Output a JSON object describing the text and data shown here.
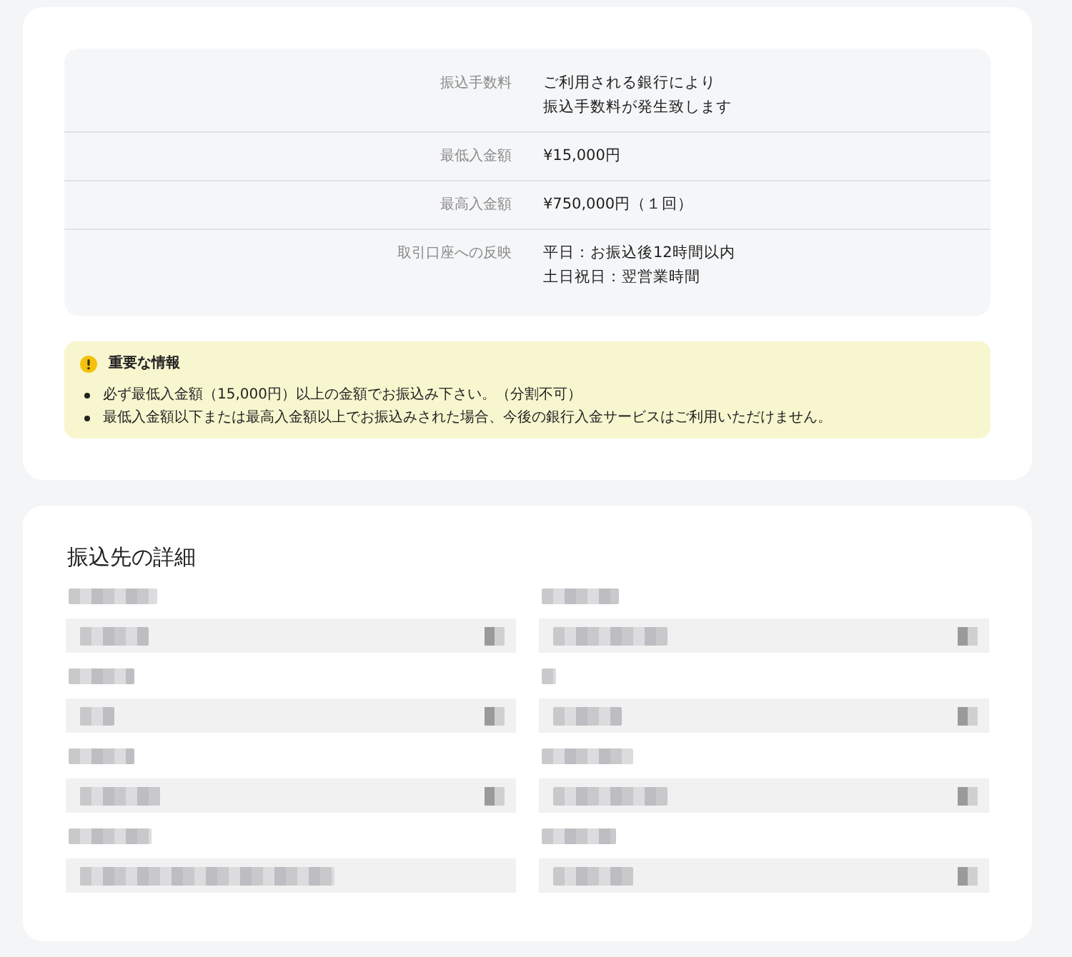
{
  "fee_table": {
    "rows": [
      {
        "label": "振込手数料",
        "value_lines": [
          "ご利用される銀行により",
          "振込手数料が発生致します"
        ]
      },
      {
        "label": "最低入金額",
        "value_lines": [
          "¥15,000円"
        ]
      },
      {
        "label": "最高入金額",
        "value_lines": [
          "¥750,000円（１回）"
        ]
      },
      {
        "label": "取引口座への反映",
        "value_lines": [
          "平日：お振込後12時間以内",
          "土日祝日：翌営業時間"
        ]
      }
    ]
  },
  "notice": {
    "title": "重要な情報",
    "items": [
      "必ず最低入金額（15,000円）以上の金額でお振込み下さい。（分割不可）",
      "最低入金額以下または最高入金額以上でお振込みされた場合、今後の銀行入金サービスはご利用いただけません。"
    ]
  },
  "transfer_details": {
    "title": "振込先の詳細",
    "fields": [
      {
        "redacted": true,
        "copy_button": true
      },
      {
        "redacted": true,
        "copy_button": true
      },
      {
        "redacted": true,
        "copy_button": true
      },
      {
        "redacted": true,
        "copy_button": true
      },
      {
        "redacted": true,
        "copy_button": true
      },
      {
        "redacted": true,
        "copy_button": true
      },
      {
        "redacted": true,
        "copy_button": false
      },
      {
        "redacted": true,
        "copy_button": true
      }
    ]
  }
}
